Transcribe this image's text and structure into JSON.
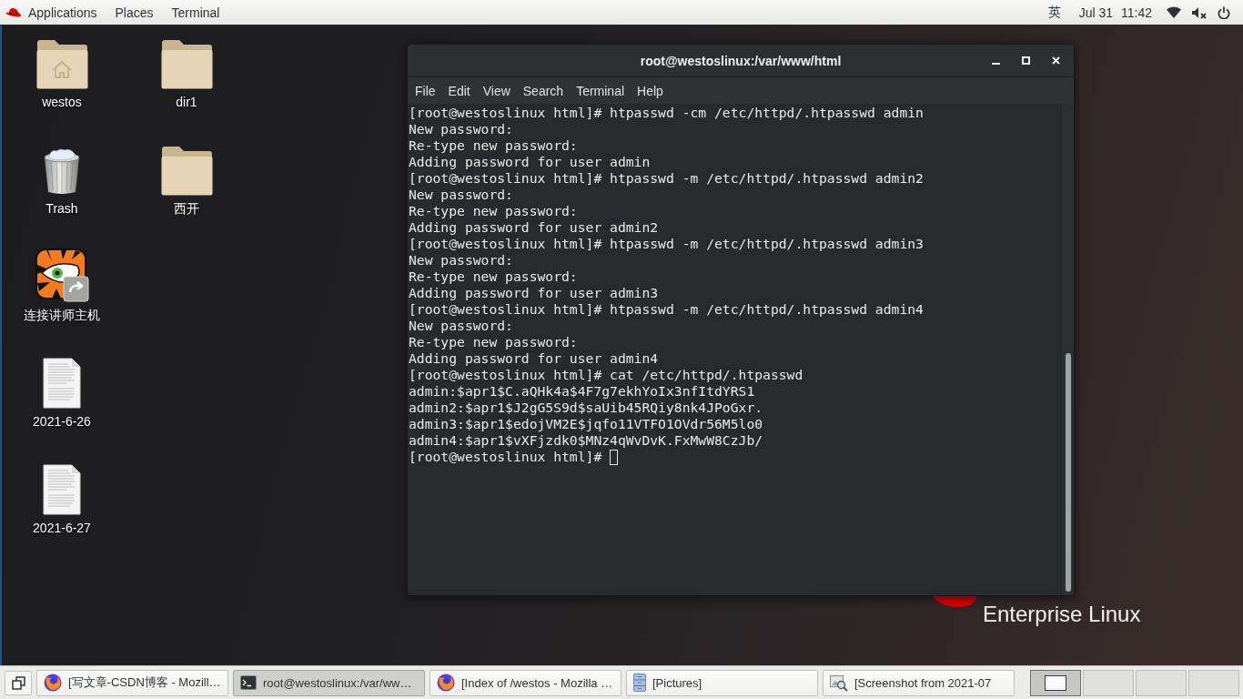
{
  "top_bar": {
    "menus": [
      "Applications",
      "Places",
      "Terminal"
    ],
    "input_method": "英",
    "date": "Jul 31",
    "time": "11:42",
    "volume_muted": true
  },
  "desktop_icons": [
    {
      "label": "westos",
      "kind": "home-folder"
    },
    {
      "label": "Trash",
      "kind": "trash"
    },
    {
      "label": "连接讲师主机",
      "kind": "launcher"
    },
    {
      "label": "2021-6-26",
      "kind": "document"
    },
    {
      "label": "2021-6-27",
      "kind": "document"
    },
    {
      "label": "dir1",
      "kind": "folder"
    },
    {
      "label": "西开",
      "kind": "folder"
    }
  ],
  "wallpaper_logo": {
    "text": "Enterprise Linux"
  },
  "terminal": {
    "title": "root@westoslinux:/var/www/html",
    "menu": [
      "File",
      "Edit",
      "View",
      "Search",
      "Terminal",
      "Help"
    ],
    "lines": [
      "[root@westoslinux html]# htpasswd -cm /etc/httpd/.htpasswd admin",
      "New password:",
      "Re-type new password:",
      "Adding password for user admin",
      "[root@westoslinux html]# htpasswd -m /etc/httpd/.htpasswd admin2",
      "New password:",
      "Re-type new password:",
      "Adding password for user admin2",
      "[root@westoslinux html]# htpasswd -m /etc/httpd/.htpasswd admin3",
      "New password:",
      "Re-type new password:",
      "Adding password for user admin3",
      "[root@westoslinux html]# htpasswd -m /etc/httpd/.htpasswd admin4",
      "New password:",
      "Re-type new password:",
      "Adding password for user admin4",
      "[root@westoslinux html]# cat /etc/httpd/.htpasswd",
      "admin:$apr1$C.aQHk4a$4F7g7ekhYoIx3nfItdYRS1",
      "admin2:$apr1$J2gG5S9d$saUib45RQiy8nk4JPoGxr.",
      "admin3:$apr1$edojVM2E$jqfo11VTFO1OVdr56M5lo0",
      "admin4:$apr1$vXFjzdk0$MNz4qWvDvK.FxMwW8CzJb/"
    ],
    "prompt": "[root@westoslinux html]#"
  },
  "taskbar": {
    "windows": [
      {
        "title": "[写文章-CSDN博客 - Mozill…",
        "kind": "browser",
        "selected": false
      },
      {
        "title": "root@westoslinux:/var/ww…",
        "kind": "terminal",
        "selected": true
      },
      {
        "title": "[Index of /westos - Mozilla …",
        "kind": "browser",
        "selected": false
      },
      {
        "title": "[Pictures]",
        "kind": "files",
        "selected": false
      },
      {
        "title": "[Screenshot from 2021-07",
        "kind": "image-viewer",
        "selected": false
      }
    ],
    "workspaces": [
      {
        "selected": true
      },
      {
        "selected": false
      },
      {
        "selected": false
      },
      {
        "selected": false
      }
    ]
  }
}
